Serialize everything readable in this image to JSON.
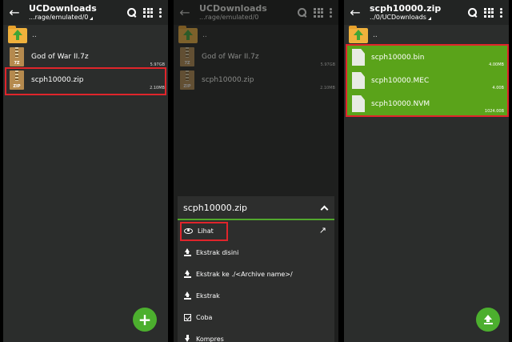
{
  "panel1": {
    "title": "UCDownloads",
    "path": "...rage/emulated/0",
    "updir_label": "..",
    "files": [
      {
        "name": "God of War II.7z",
        "size": "5.97GB",
        "badge": "7Z"
      },
      {
        "name": "scph10000.zip",
        "size": "2.10MB",
        "badge": "ZIP"
      }
    ],
    "fab_icon": "plus-icon"
  },
  "panel2": {
    "title": "UCDownloads",
    "path": "...rage/emulated/0",
    "updir_label": "..",
    "files": [
      {
        "name": "God of War II.7z",
        "size": "5.97GB",
        "badge": "7Z"
      },
      {
        "name": "scph10000.zip",
        "size": "2.10MB",
        "badge": "ZIP"
      }
    ],
    "sheet": {
      "title": "scph10000.zip",
      "items": [
        {
          "label": "Lihat",
          "icon": "eye-icon"
        },
        {
          "label": "Ekstrak disini",
          "icon": "upload-arrow-icon"
        },
        {
          "label": "Ekstrak ke ./<Archive name>/",
          "icon": "upload-arrow-icon"
        },
        {
          "label": "Ekstrak",
          "icon": "upload-arrow-icon"
        },
        {
          "label": "Coba",
          "icon": "checkbox-icon"
        },
        {
          "label": "Kompres",
          "icon": "download-arrow-icon"
        }
      ]
    }
  },
  "panel3": {
    "title": "scph10000.zip",
    "path": "../0/UCDownloads",
    "updir_label": "..",
    "files": [
      {
        "name": "scph10000.bin",
        "size": "4.00MB"
      },
      {
        "name": "scph10000.MEC",
        "size": "4.00B"
      },
      {
        "name": "scph10000.NVM",
        "size": "1024.00B"
      }
    ],
    "fab_icon": "extract-up-icon"
  },
  "colors": {
    "accent_green": "#5aa31a",
    "fab_green": "#4caf2e",
    "highlight_red": "#e0252b",
    "panel_bg": "#2b2d2c",
    "appbar_bg": "#222423"
  }
}
